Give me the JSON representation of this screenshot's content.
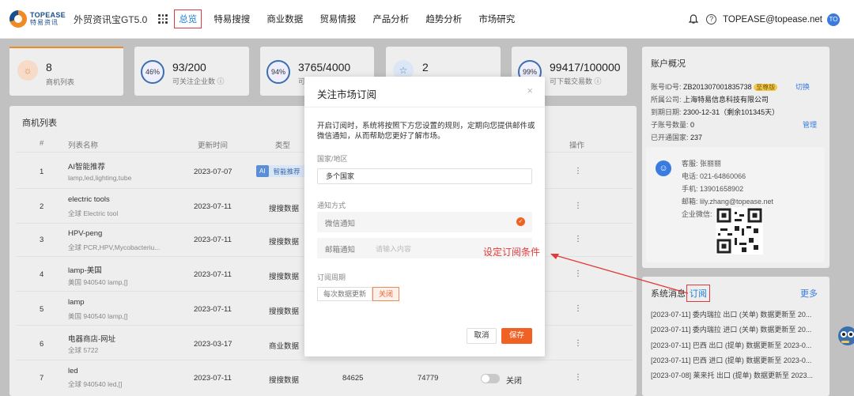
{
  "header": {
    "logo_en": "TOPEASE",
    "logo_cn": "特易资讯",
    "app_title": "外贸资讯宝GT5.0",
    "nav": [
      "总览",
      "特易搜搜",
      "商业数据",
      "贸易情报",
      "产品分析",
      "趋势分析",
      "市场研究"
    ],
    "user_email": "TOPEASE@topease.net",
    "avatar_initials": "TO"
  },
  "stats": [
    {
      "value": "8",
      "label": "商机列表"
    },
    {
      "value": "93/200",
      "label": "可关注企业数 ⓘ",
      "percent": "46%"
    },
    {
      "value": "3765/4000",
      "label": "可",
      "percent": "94%"
    },
    {
      "value": "2",
      "label": ""
    },
    {
      "value": "99417/100000",
      "label": "可下载交易数 ⓘ",
      "percent": "99%"
    }
  ],
  "opportunity": {
    "title": "商机列表",
    "columns": {
      "index": "#",
      "name": "列表名称",
      "updated": "更新时间",
      "type": "类型",
      "action": "操作"
    },
    "rows": [
      {
        "idx": "1",
        "name": "AI智能推荐",
        "sub": "lamp,led,lighting,tube",
        "date": "2023-07-07",
        "type": "智能推荐",
        "ai": "AI"
      },
      {
        "idx": "2",
        "name": "electric tools",
        "sub": "全球  Electric tool",
        "date": "2023-07-11",
        "type": "搜搜数据"
      },
      {
        "idx": "3",
        "name": "HPV-peng",
        "sub": "全球  PCR,HPV,Mycobacteriu...",
        "date": "2023-07-11",
        "type": "搜搜数据"
      },
      {
        "idx": "4",
        "name": "lamp-美国",
        "sub": "美国  940540  lamp,[]",
        "date": "2023-07-11",
        "type": "搜搜数据"
      },
      {
        "idx": "5",
        "name": "lamp",
        "sub": "美国  940540  lamp,[]",
        "date": "2023-07-11",
        "type": "搜搜数据"
      },
      {
        "idx": "6",
        "name": "电器商店-网址",
        "sub": "全球  5722",
        "date": "2023-03-17",
        "type": "商业数据"
      },
      {
        "idx": "7",
        "name": "led",
        "sub": "全球  940540  led,[]",
        "date": "2023-07-11",
        "type": "搜搜数据",
        "count1": "84625",
        "count2": "74779",
        "toggle": "关闭"
      }
    ],
    "dots": "⋮"
  },
  "account": {
    "title": "账户概况",
    "id_label": "账号ID号:",
    "id_value": "ZB201307001835738",
    "vip": "至尊版",
    "switch": "切换",
    "company_label": "所属公司:",
    "company_value": "上海特易信息科技有限公司",
    "expire_label": "到期日期:",
    "expire_value": "2300-12-31（剩余101345天）",
    "sub_label": "子账号数量:",
    "sub_value": "0",
    "manage": "管理",
    "country_label": "已开通国家:",
    "country_value": "237",
    "cs_label": "客服:",
    "cs_name": "张丽丽",
    "tel_label": "电话:",
    "tel_value": "021-64860066",
    "mobile_label": "手机:",
    "mobile_value": "13901658902",
    "email_label": "邮箱:",
    "email_value": "lily.zhang@topease.net",
    "wechat_label": "企业微信:"
  },
  "system": {
    "title": "系统消息",
    "subscribe": "订阅",
    "more": "更多",
    "messages": [
      "[2023-07-11] 委内瑞拉 出口 (关单) 数据更新至 20...",
      "[2023-07-11] 委内瑞拉 进口 (关单) 数据更新至 20...",
      "[2023-07-11] 巴西 出口 (提单) 数据更新至 2023-0...",
      "[2023-07-11] 巴西 进口 (提单) 数据更新至 2023-0...",
      "[2023-07-08] 莱来托 出口 (提单) 数据更新至 2023..."
    ]
  },
  "modal": {
    "title": "关注市场订阅",
    "close": "×",
    "desc": "开启订阅时，系统将按照下方您设置的规则，定期向您提供邮件或微信通知，从而帮助您更好了解市场。",
    "country_label": "国家/地区",
    "country_value": "多个国家",
    "notify_label": "通知方式",
    "wechat": "微信通知",
    "mail": "邮箱通知",
    "mail_placeholder": "请输入内容",
    "cycle_label": "订阅周期",
    "cycle_options": [
      "每次数据更新",
      "关闭"
    ],
    "cancel": "取消",
    "save": "保存"
  },
  "annotation": "设定订阅条件",
  "colors": {
    "brand": "#f06224",
    "link": "#1a7fd6",
    "highlight": "#e23a3a"
  }
}
